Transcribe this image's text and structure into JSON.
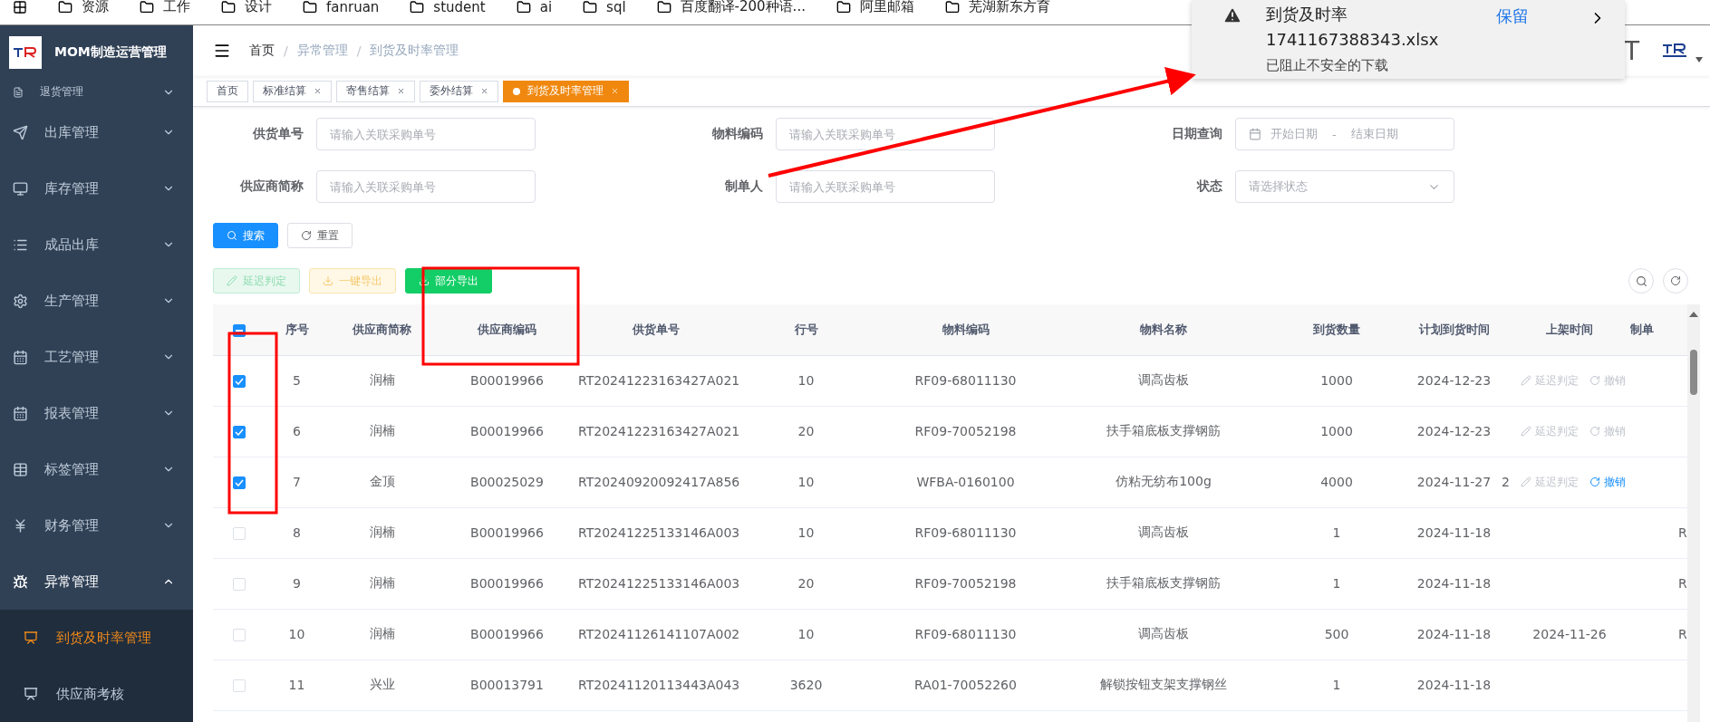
{
  "bookmarks": [
    "资源",
    "工作",
    "设计",
    "fanruan",
    "student",
    "ai",
    "sql",
    "百度翻译-200种语...",
    "阿里邮箱",
    "芜湖新东方育"
  ],
  "app_title": "MOM制造运营管理",
  "sidebar": {
    "items": [
      {
        "label": "退货管理",
        "expanded": false
      },
      {
        "label": "出库管理",
        "expanded": false
      },
      {
        "label": "库存管理",
        "expanded": false
      },
      {
        "label": "成品出库",
        "expanded": false
      },
      {
        "label": "生产管理",
        "expanded": false
      },
      {
        "label": "工艺管理",
        "expanded": false
      },
      {
        "label": "报表管理",
        "expanded": false
      },
      {
        "label": "标签管理",
        "expanded": false
      },
      {
        "label": "财务管理",
        "expanded": false
      },
      {
        "label": "异常管理",
        "expanded": true,
        "children": [
          {
            "label": "到货及时率管理",
            "selected": true
          },
          {
            "label": "供应商考核",
            "selected": false
          }
        ]
      }
    ]
  },
  "breadcrumb": [
    "首页",
    "异常管理",
    "到货及时率管理"
  ],
  "breadcrumb_separator": "/",
  "navbar_text": "T",
  "tags": [
    {
      "label": "首页",
      "selected": false,
      "closable": false
    },
    {
      "label": "标准结算",
      "selected": false,
      "closable": true
    },
    {
      "label": "寄售结算",
      "selected": false,
      "closable": true
    },
    {
      "label": "委外结算",
      "selected": false,
      "closable": true
    },
    {
      "label": "到货及时率管理",
      "selected": true,
      "closable": true
    }
  ],
  "filters": [
    {
      "label": "供货单号",
      "kind": "input",
      "placeholder": "请输入关联采购单号"
    },
    {
      "label": "物料编码",
      "kind": "input",
      "placeholder": "请输入关联采购单号"
    },
    {
      "label": "日期查询",
      "kind": "daterange",
      "start_placeholder": "开始日期",
      "separator": "-",
      "end_placeholder": "结束日期"
    },
    {
      "label": "供应商简称",
      "kind": "input",
      "placeholder": "请输入关联采购单号"
    },
    {
      "label": "制单人",
      "kind": "input",
      "placeholder": "请输入关联采购单号"
    },
    {
      "label": "状态",
      "kind": "select",
      "placeholder": "请选择状态"
    }
  ],
  "search_buttons": [
    {
      "label": "搜索",
      "kind": "primary"
    },
    {
      "label": "重置",
      "kind": "default"
    }
  ],
  "actions": [
    {
      "label": "延迟判定",
      "kind": "success",
      "disabled": true
    },
    {
      "label": "一键导出",
      "kind": "warning",
      "disabled": true
    },
    {
      "label": "部分导出",
      "kind": "success",
      "disabled": false
    }
  ],
  "table": {
    "header_indeterminate": true,
    "columns": [
      "序号",
      "供应商简称",
      "供应商编码",
      "供货单号",
      "行号",
      "物料编码",
      "物料名称",
      "到货数量",
      "计划到货时间",
      "上架时间",
      "制单"
    ],
    "rows": [
      {
        "selected": true,
        "cells": [
          "5",
          "润楠",
          "B00019966",
          "RT20241223163427A021",
          "10",
          "RF09-68011130",
          "调高齿板",
          "1000",
          "2024-12-23",
          "",
          ""
        ],
        "row_actions": [
          {
            "label": "延迟判定",
            "disabled": true
          },
          {
            "label": "撤销",
            "disabled": true
          }
        ]
      },
      {
        "selected": true,
        "cells": [
          "6",
          "润楠",
          "B00019966",
          "RT20241223163427A021",
          "20",
          "RF09-70052198",
          "扶手箱底板支撑钢筋",
          "1000",
          "2024-12-23",
          "",
          ""
        ],
        "row_actions": [
          {
            "label": "延迟判定",
            "disabled": true
          },
          {
            "label": "撤销",
            "disabled": true
          }
        ]
      },
      {
        "selected": true,
        "cells": [
          "7",
          "金顶",
          "B00025029",
          "RT20240920092417A856",
          "10",
          "WFBA-0160100",
          "仿粘无纺布100g",
          "4000",
          "2024-11-27",
          "2",
          ""
        ],
        "row_actions": [
          {
            "label": "延迟判定",
            "disabled": true
          },
          {
            "label": "撤销",
            "disabled": false
          }
        ]
      },
      {
        "selected": false,
        "cells": [
          "8",
          "润楠",
          "B00019966",
          "RT20241225133146A003",
          "10",
          "RF09-68011130",
          "调高齿板",
          "1",
          "2024-11-18",
          "",
          "R"
        ]
      },
      {
        "selected": false,
        "cells": [
          "9",
          "润楠",
          "B00019966",
          "RT20241225133146A003",
          "20",
          "RF09-70052198",
          "扶手箱底板支撑钢筋",
          "1",
          "2024-11-18",
          "",
          "R"
        ]
      },
      {
        "selected": false,
        "cells": [
          "10",
          "润楠",
          "B00019966",
          "RT20241126141107A002",
          "10",
          "RF09-68011130",
          "调高齿板",
          "500",
          "2024-11-18",
          "2024-11-26",
          "R"
        ]
      },
      {
        "selected": false,
        "cells": [
          "11",
          "兴业",
          "B00013791",
          "RT20241120113443A043",
          "3620",
          "RA01-70052260",
          "解锁按钮支架支撑钢丝",
          "1",
          "2024-11-18",
          "",
          ""
        ]
      }
    ]
  },
  "download": {
    "title": "到货及时率",
    "filename": "1741167388343.xlsx",
    "status": "已阻止不安全的下载",
    "keep": "保留"
  }
}
